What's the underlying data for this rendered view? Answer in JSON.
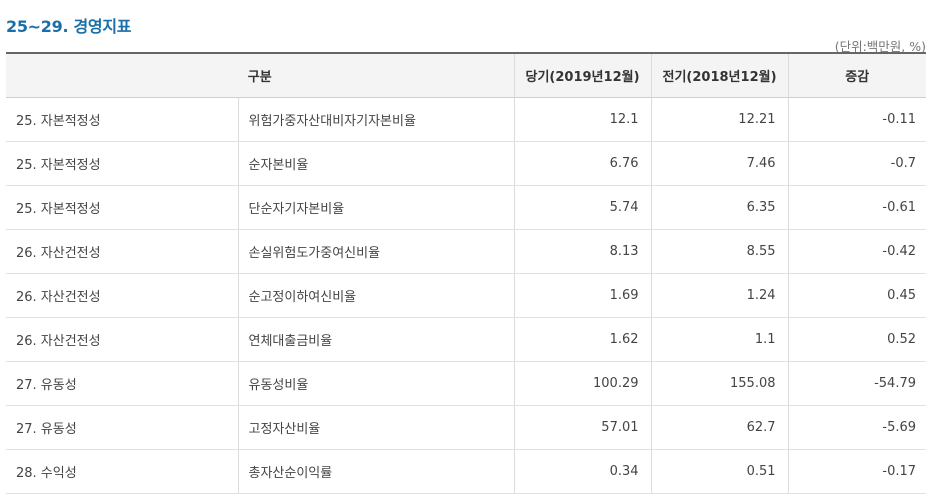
{
  "section": {
    "title": "25~29. 경영지표",
    "unit_note": "(단위:백만원, %)"
  },
  "table": {
    "headers": {
      "category": "구분",
      "current": "당기(2019년12월)",
      "previous": "전기(2018년12월)",
      "change": "증감"
    },
    "rows": [
      {
        "category": "25. 자본적정성",
        "item": "위험가중자산대비자기자본비율",
        "current": "12.1",
        "previous": "12.21",
        "change": "-0.11"
      },
      {
        "category": "25. 자본적정성",
        "item": "순자본비율",
        "current": "6.76",
        "previous": "7.46",
        "change": "-0.7"
      },
      {
        "category": "25. 자본적정성",
        "item": "단순자기자본비율",
        "current": "5.74",
        "previous": "6.35",
        "change": "-0.61"
      },
      {
        "category": "26. 자산건전성",
        "item": "손실위험도가중여신비율",
        "current": "8.13",
        "previous": "8.55",
        "change": "-0.42"
      },
      {
        "category": "26. 자산건전성",
        "item": "순고정이하여신비율",
        "current": "1.69",
        "previous": "1.24",
        "change": "0.45"
      },
      {
        "category": "26. 자산건전성",
        "item": "연체대출금비율",
        "current": "1.62",
        "previous": "1.1",
        "change": "0.52"
      },
      {
        "category": "27. 유동성",
        "item": "유동성비율",
        "current": "100.29",
        "previous": "155.08",
        "change": "-54.79"
      },
      {
        "category": "27. 유동성",
        "item": "고정자산비율",
        "current": "57.01",
        "previous": "62.7",
        "change": "-5.69"
      },
      {
        "category": "28. 수익성",
        "item": "총자산순이익률",
        "current": "0.34",
        "previous": "0.51",
        "change": "-0.17"
      }
    ]
  }
}
